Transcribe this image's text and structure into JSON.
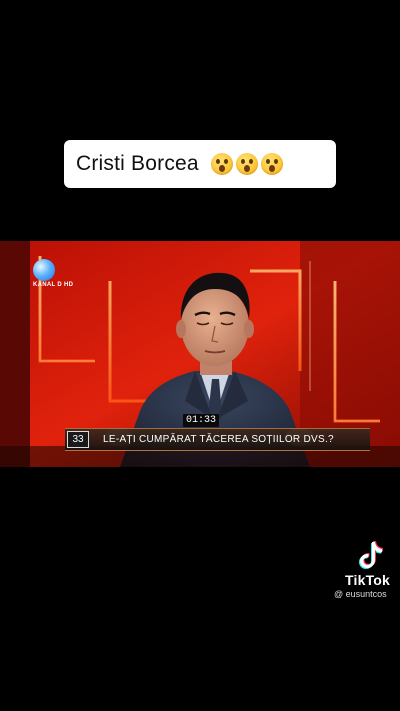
{
  "caption": {
    "text": "Cristi Borcea",
    "emojis": [
      "astonished-face-emoji",
      "astonished-face-emoji",
      "astonished-face-emoji"
    ]
  },
  "video": {
    "channel_logo_text": "KANAL D HD",
    "timer": "01:33",
    "episode_number": "33",
    "question": "LE-AȚI CUMPĂRAT TĂCEREA SOȚIILOR DVS.?"
  },
  "watermark": {
    "brand": "TikTok",
    "handle": "@ eusuntcos"
  },
  "colors": {
    "background": "#000000",
    "studio_red": "#d81a0a",
    "studio_orange": "#ff7a1a",
    "caption_bg": "#ffffff"
  }
}
